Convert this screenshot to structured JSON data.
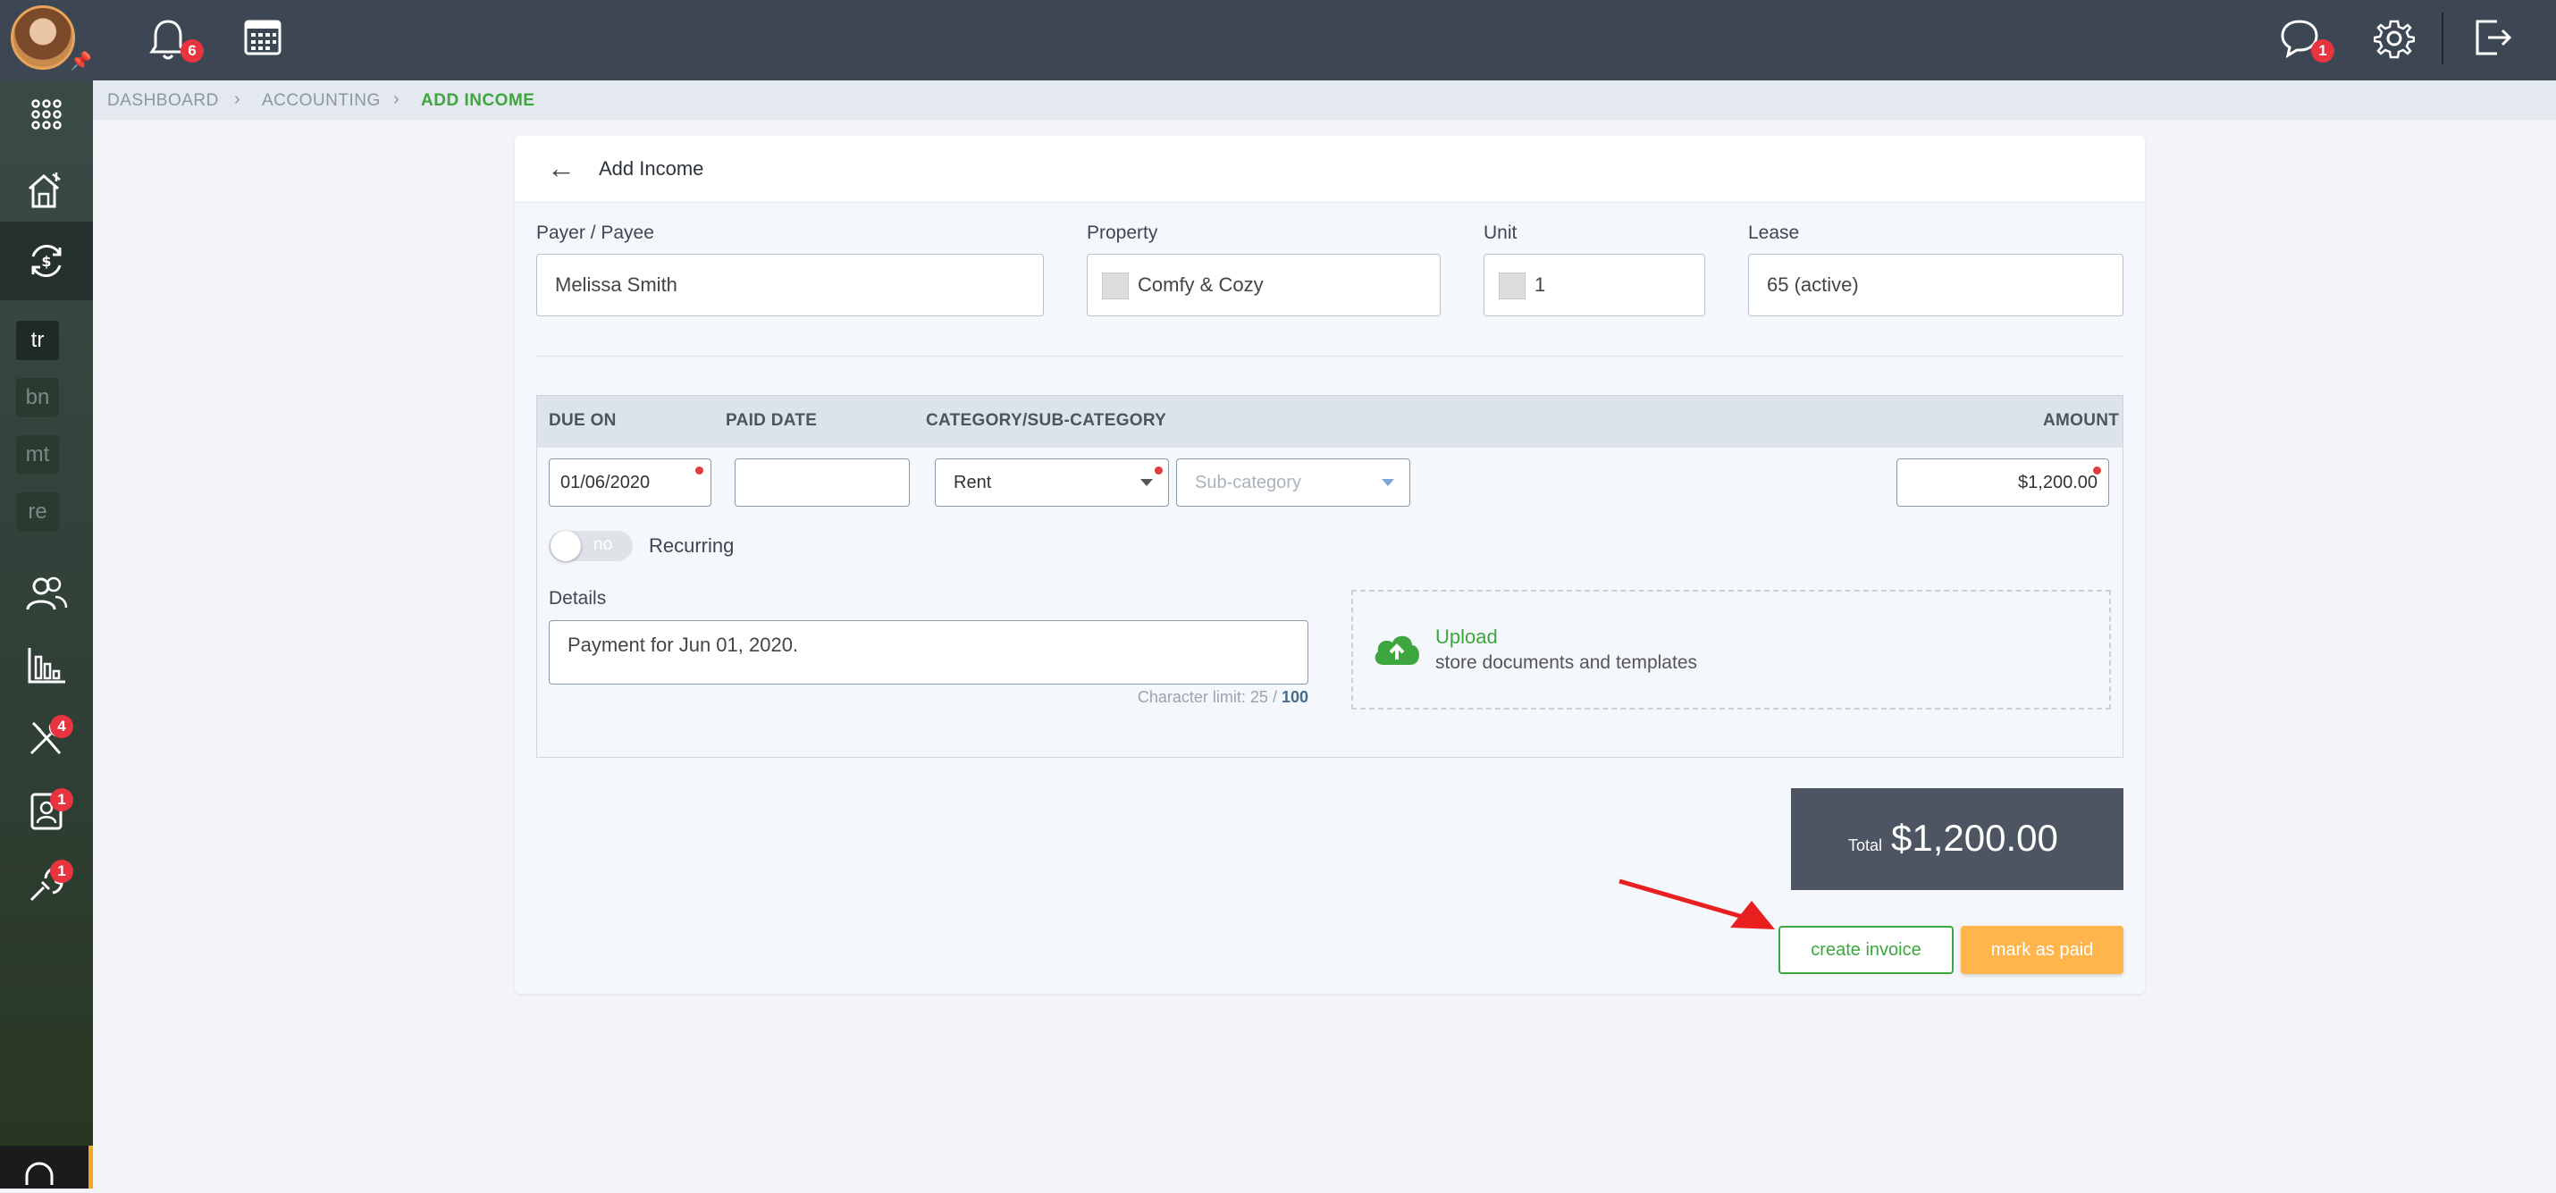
{
  "topbar": {
    "notifications_count": "6",
    "messages_count": "1",
    "icons": [
      "bell-icon",
      "calendar-icon",
      "chat-icon",
      "gear-icon",
      "logout-icon"
    ]
  },
  "sidebar": {
    "icons": [
      "apps-grid-icon",
      "properties-icon",
      "accounting-icon",
      "people-icon",
      "reports-icon",
      "maintenance-icon",
      "contacts-icon",
      "tools-icon"
    ],
    "abbr": [
      "tr",
      "bn",
      "mt",
      "re"
    ],
    "badges": {
      "maintenance": "4",
      "contacts": "1",
      "tools": "1"
    }
  },
  "breadcrumb": [
    "DASHBOARD",
    "ACCOUNTING",
    "ADD INCOME"
  ],
  "page": {
    "title": "Add Income"
  },
  "form": {
    "payer_label": "Payer / Payee",
    "payer_value": "Melissa Smith",
    "property_label": "Property",
    "property_value": "Comfy & Cozy",
    "unit_label": "Unit",
    "unit_value": "1",
    "lease_label": "Lease",
    "lease_value": "65 (active)"
  },
  "table": {
    "headers": [
      "DUE ON",
      "PAID DATE",
      "CATEGORY/SUB-CATEGORY",
      "AMOUNT"
    ],
    "due_on": "01/06/2020",
    "paid_date": "",
    "category": "Rent",
    "subcategory_placeholder": "Sub-category",
    "amount": "$1,200.00",
    "recurring_toggle": "no",
    "recurring_label": "Recurring",
    "details_label": "Details",
    "details_value": "Payment for Jun 01, 2020.",
    "char_limit_prefix": "Character limit: 25 / ",
    "char_limit_max": "100",
    "upload_title": "Upload",
    "upload_subtitle": "store documents and templates"
  },
  "total": {
    "label": "Total",
    "value": "$1,200.00"
  },
  "actions": {
    "create_invoice": "create invoice",
    "mark_as_paid": "mark as paid"
  },
  "colors": {
    "accent_green": "#3ea63e",
    "orange": "#fdb54c",
    "badge_red": "#e8343f",
    "topbar": "#3d4753"
  }
}
